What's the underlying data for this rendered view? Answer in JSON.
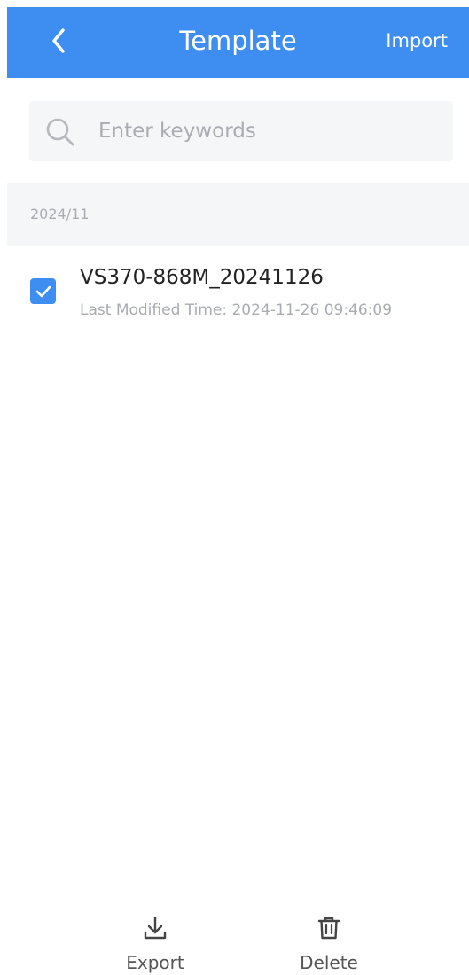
{
  "header": {
    "title": "Template",
    "import_label": "Import",
    "background_color": "#3e8ef2",
    "back_icon": "chevron-left-icon"
  },
  "search": {
    "placeholder": "Enter keywords",
    "value": "",
    "icon": "search-icon"
  },
  "section": {
    "label": "2024/11"
  },
  "templates": [
    {
      "name": "VS370-868M_20241126",
      "modified": "Last Modified Time: 2024-11-26 09:46:09",
      "checked": true
    }
  ],
  "actions": {
    "export_label": "Export",
    "export_icon": "download-icon",
    "delete_label": "Delete",
    "delete_icon": "trash-icon"
  },
  "colors": {
    "accent": "#3e8ef2",
    "muted_text": "#a9acb2",
    "section_background": "#f5f6f7"
  }
}
